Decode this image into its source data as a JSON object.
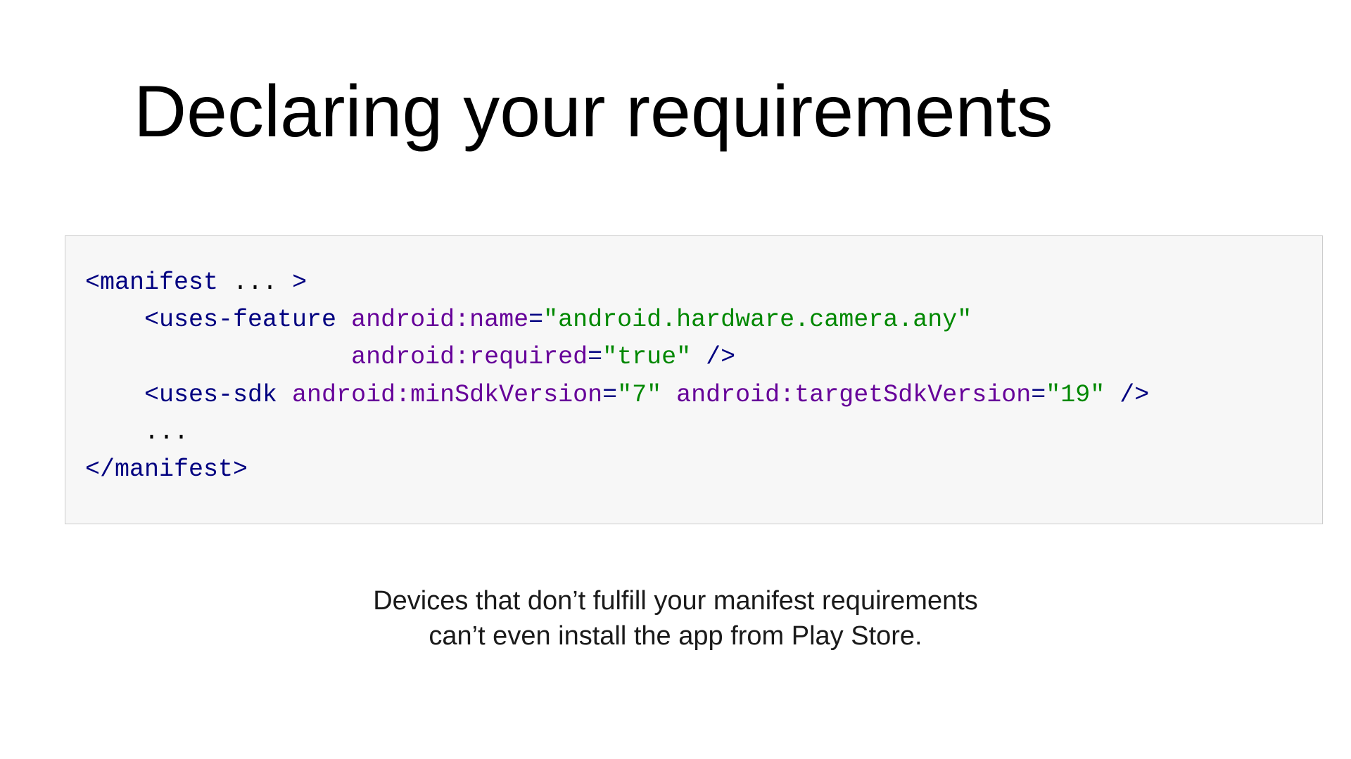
{
  "title": "Declaring your requirements",
  "code": {
    "l1_open": "<manifest",
    "l1_dots": " ... ",
    "l1_close": ">",
    "l2_open": "<uses-feature",
    "l2_attr1": " android:name",
    "l2_eq1": "=",
    "l2_val1": "\"android.hardware.camera.any\"",
    "l3_attr2": "android:required",
    "l3_eq2": "=",
    "l3_val2": "\"true\"",
    "l3_close": " />",
    "l4_open": "<uses-sdk",
    "l4_attr1": " android:minSdkVersion",
    "l4_eq1": "=",
    "l4_val1": "\"7\"",
    "l4_attr2": " android:targetSdkVersion",
    "l4_eq2": "=",
    "l4_val2": "\"19\"",
    "l4_close": " />",
    "l5_dots": "...",
    "l6_close": "</manifest>"
  },
  "caption_line1": "Devices that don’t fulfill your manifest requirements",
  "caption_line2": "can’t even install the app from Play Store."
}
